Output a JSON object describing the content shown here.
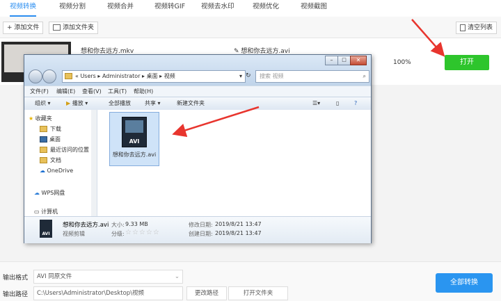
{
  "tabs": [
    {
      "label": "视频转换",
      "active": true
    },
    {
      "label": "视频分割",
      "active": false
    },
    {
      "label": "视频合并",
      "active": false
    },
    {
      "label": "视频转GIF",
      "active": false
    },
    {
      "label": "视频去水印",
      "active": false
    },
    {
      "label": "视频优化",
      "active": false
    },
    {
      "label": "视频截图",
      "active": false
    }
  ],
  "toolbar": {
    "add_file": "+ 添加文件",
    "add_folder": "添加文件夹",
    "clear_list": "清空列表"
  },
  "file_row": {
    "input_name": "想和你去远方.mkv",
    "output_name": "想和你去远方.avi",
    "progress": "100%",
    "open_label": "打开"
  },
  "bottom": {
    "format_label": "输出格式",
    "format_value": "AVI   同原文件",
    "path_label": "输出路径",
    "path_value": "C:\\Users\\Administrator\\Desktop\\视频",
    "change_path": "更改路径",
    "open_folder": "打开文件夹",
    "convert_all": "全部转换"
  },
  "explorer": {
    "address": [
      "Users",
      "Administrator",
      "桌面",
      "视频"
    ],
    "search_placeholder": "搜索 视频",
    "menu": [
      "文件(F)",
      "编辑(E)",
      "查看(V)",
      "工具(T)",
      "帮助(H)"
    ],
    "commands": [
      "组织 ▾",
      "播放 ▾",
      "全部播放",
      "共享 ▾",
      "新建文件夹"
    ],
    "nav": {
      "favorites": "收藏夹",
      "items": [
        "下载",
        "桌面",
        "最近访问的位置",
        "文档"
      ],
      "onedrive": "OneDrive",
      "wps": "WPS网盘",
      "computer": "计算机"
    },
    "file": {
      "name": "想和你去远方.avi",
      "type_label": "AVI"
    },
    "details": {
      "name": "想和你去远方.avi",
      "type": "视频剪辑",
      "size_label": "大小:",
      "size": "9.33 MB",
      "rating_label": "分级:",
      "modified_label": "修改日期:",
      "modified": "2019/8/21 13:47",
      "created_label": "创建日期:",
      "created": "2019/8/21 13:47"
    }
  },
  "colors": {
    "accent_blue": "#2b8ef0",
    "open_green": "#2ec52c",
    "arrow_red": "#e8352e"
  }
}
